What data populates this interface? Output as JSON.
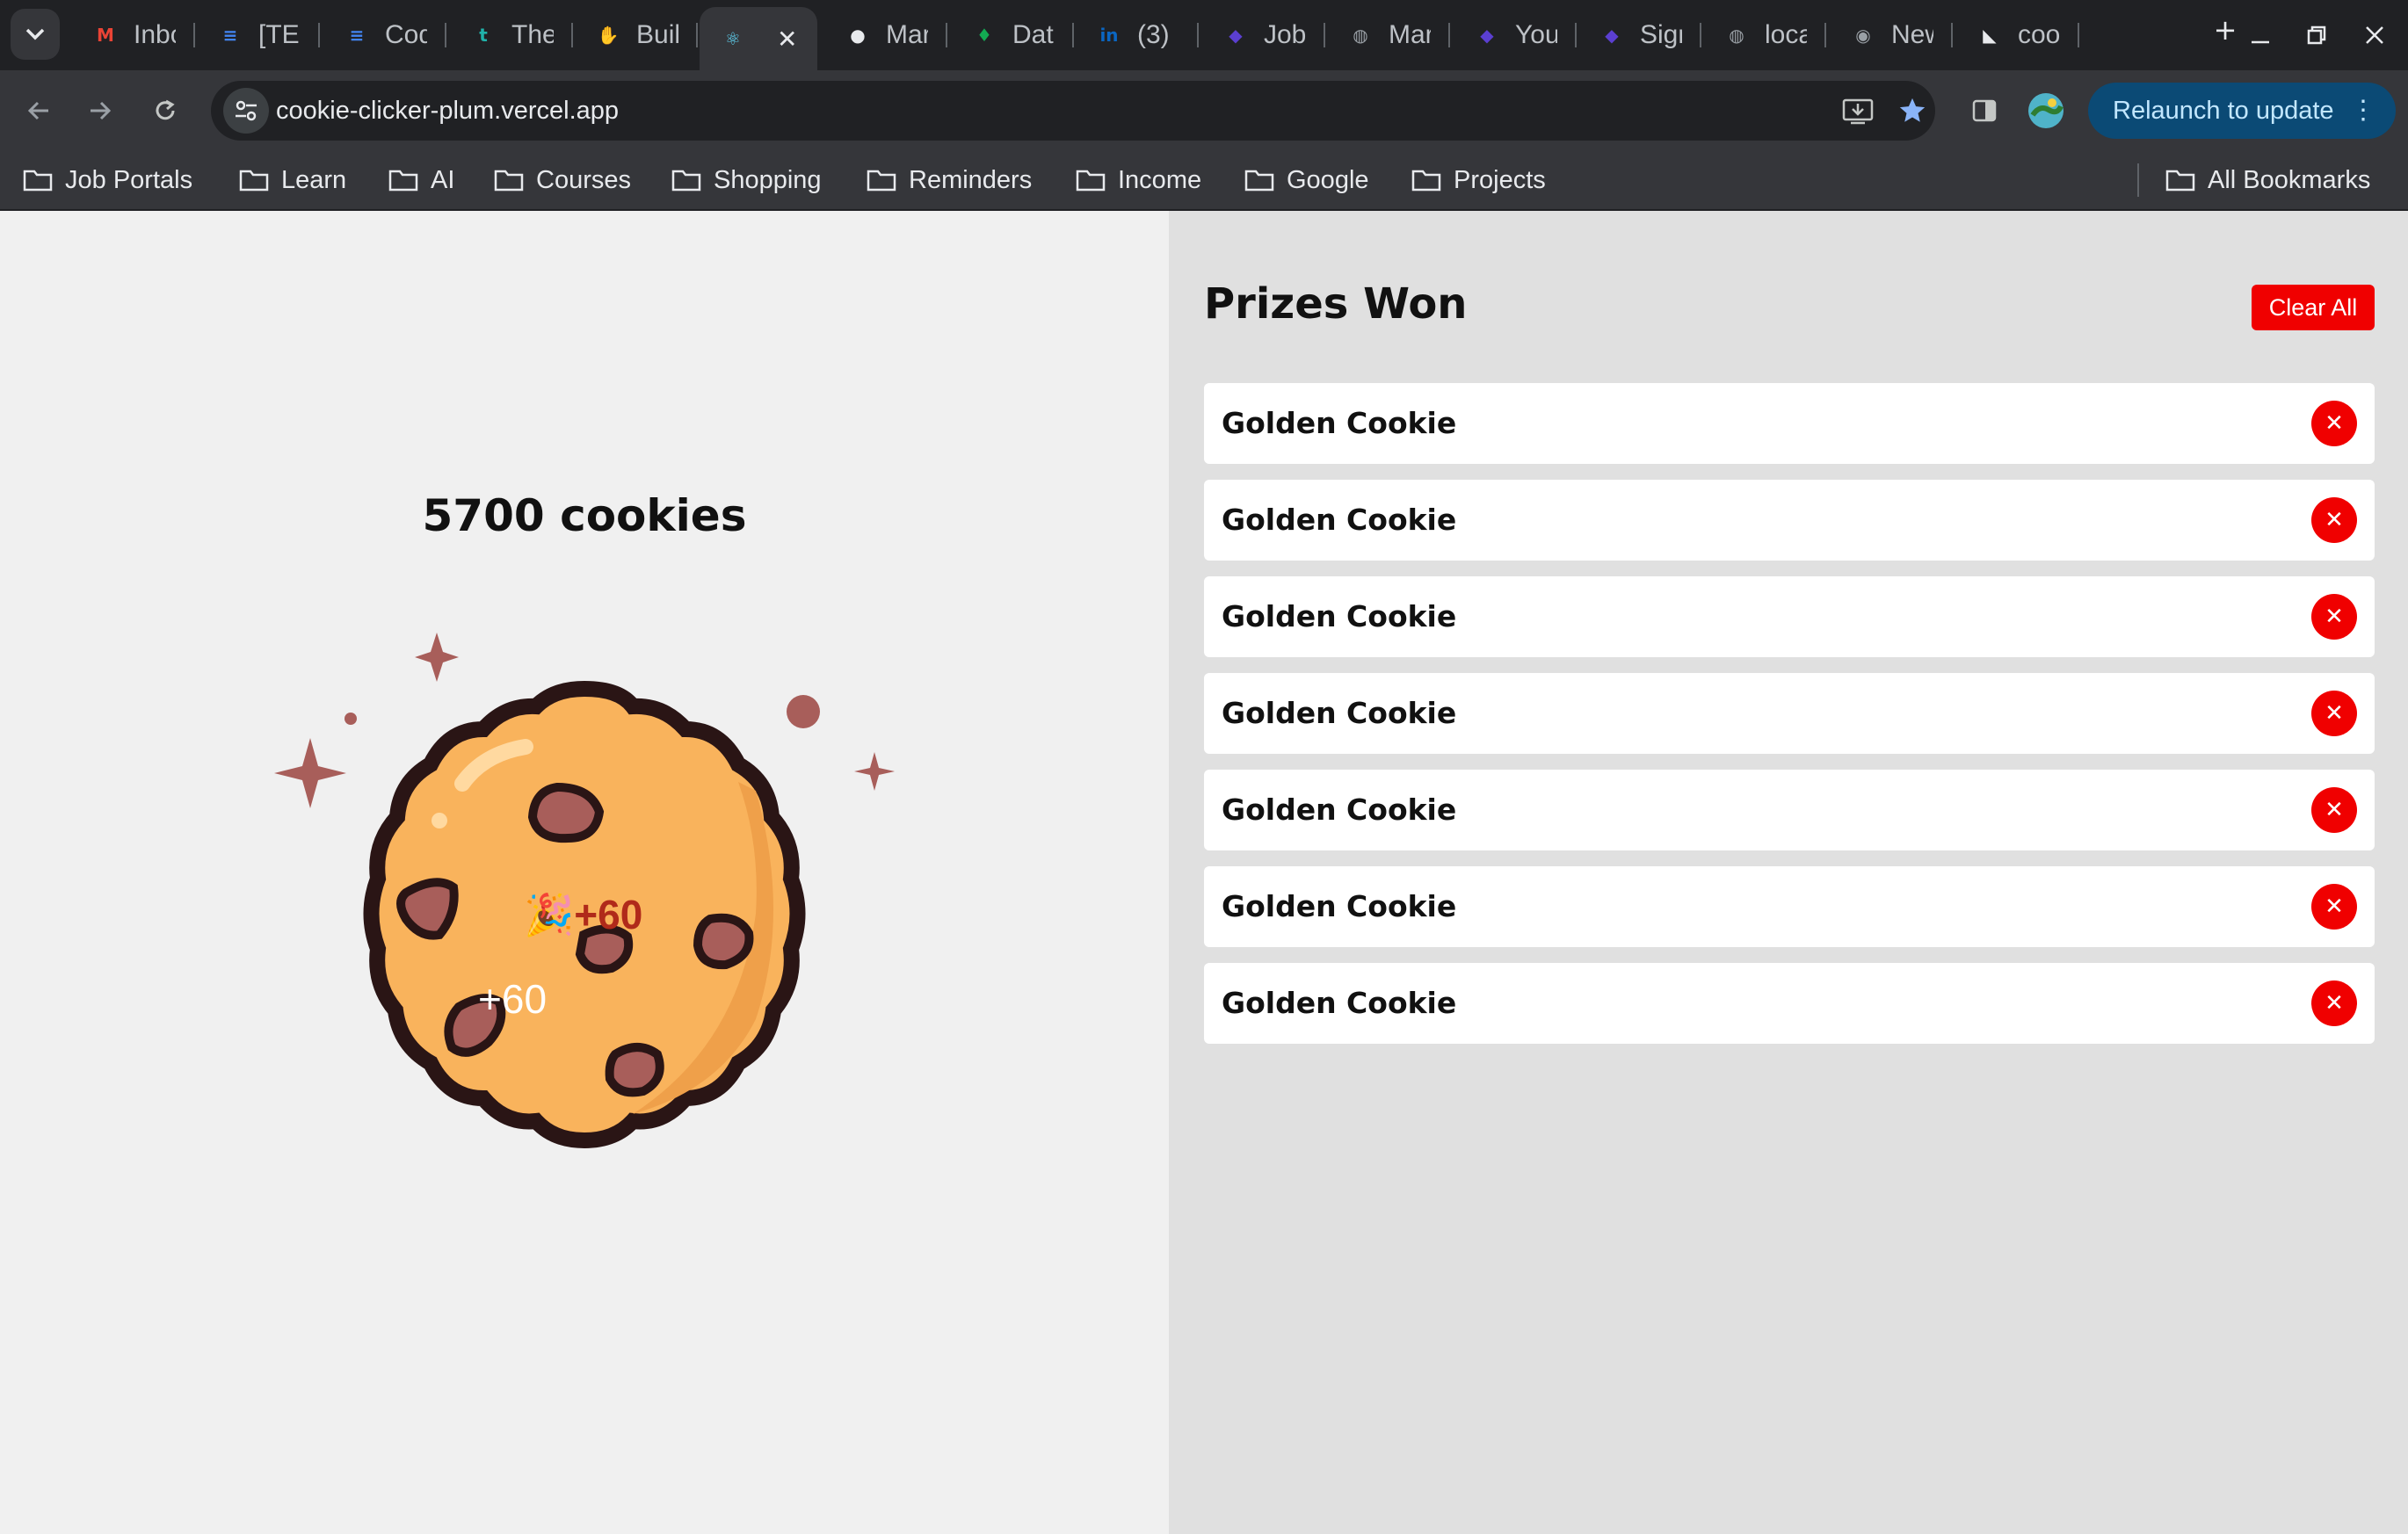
{
  "browser": {
    "tabs": [
      {
        "title": "Inbo",
        "icon": "gmail-icon",
        "color": "#ea4335",
        "glyph": "M"
      },
      {
        "title": "[TEC",
        "icon": "google-docs-icon",
        "color": "#4285f4",
        "glyph": "≡"
      },
      {
        "title": "Cod",
        "icon": "google-docs-icon",
        "color": "#4285f4",
        "glyph": "≡"
      },
      {
        "title": "The",
        "icon": "t-logo-icon",
        "color": "#20b2aa",
        "glyph": "t"
      },
      {
        "title": "Buil",
        "icon": "hand-icon",
        "color": "#f4c542",
        "glyph": "✋"
      },
      {
        "title": "",
        "icon": "react-icon",
        "color": "#61dafb",
        "glyph": "⚛",
        "active": true
      },
      {
        "title": "Mar",
        "icon": "github-icon",
        "color": "#e8eaed",
        "glyph": "●"
      },
      {
        "title": "Dat",
        "icon": "mongodb-leaf-icon",
        "color": "#13aa52",
        "glyph": "♦"
      },
      {
        "title": "(3)",
        "icon": "linkedin-icon",
        "color": "#0a66c2",
        "glyph": "in"
      },
      {
        "title": "Job",
        "icon": "shield-icon",
        "color": "#5b3fd1",
        "glyph": "◆"
      },
      {
        "title": "Mar",
        "icon": "globe-icon",
        "color": "#9aa0a6",
        "glyph": "◍"
      },
      {
        "title": "You",
        "icon": "shield-icon",
        "color": "#5b3fd1",
        "glyph": "◆"
      },
      {
        "title": "Sign",
        "icon": "shield-icon",
        "color": "#5b3fd1",
        "glyph": "◆"
      },
      {
        "title": "loca",
        "icon": "globe-icon",
        "color": "#9aa0a6",
        "glyph": "◍"
      },
      {
        "title": "New",
        "icon": "chrome-icon",
        "color": "#9aa0a6",
        "glyph": "◉"
      },
      {
        "title": "coo",
        "icon": "vercel-icon",
        "color": "#e8eaed",
        "glyph": "◣"
      }
    ],
    "url": "cookie-clicker-plum.vercel.app",
    "relaunch_label": "Relaunch to update",
    "bookmarks": [
      "Job Portals",
      "Learn",
      "AI",
      "Courses",
      "Shopping",
      "Reminders",
      "Income",
      "Google",
      "Projects"
    ],
    "all_bookmarks_label": "All Bookmarks"
  },
  "app": {
    "cookie_count": "5700 cookies",
    "floating_bonus_emoji": "🎉",
    "floating_bonus": "+60",
    "floating_click": "+60",
    "prizes_title": "Prizes Won",
    "clear_all_label": "Clear All",
    "prizes": [
      "Golden Cookie",
      "Golden Cookie",
      "Golden Cookie",
      "Golden Cookie",
      "Golden Cookie",
      "Golden Cookie",
      "Golden Cookie"
    ],
    "remove_label": "✕"
  },
  "colors": {
    "accent_red": "#f00000",
    "cookie_fill": "#f9b35c",
    "cookie_outline": "#2a1515",
    "chip": "#a85e5a",
    "relaunch_bg": "#0b4a75"
  }
}
